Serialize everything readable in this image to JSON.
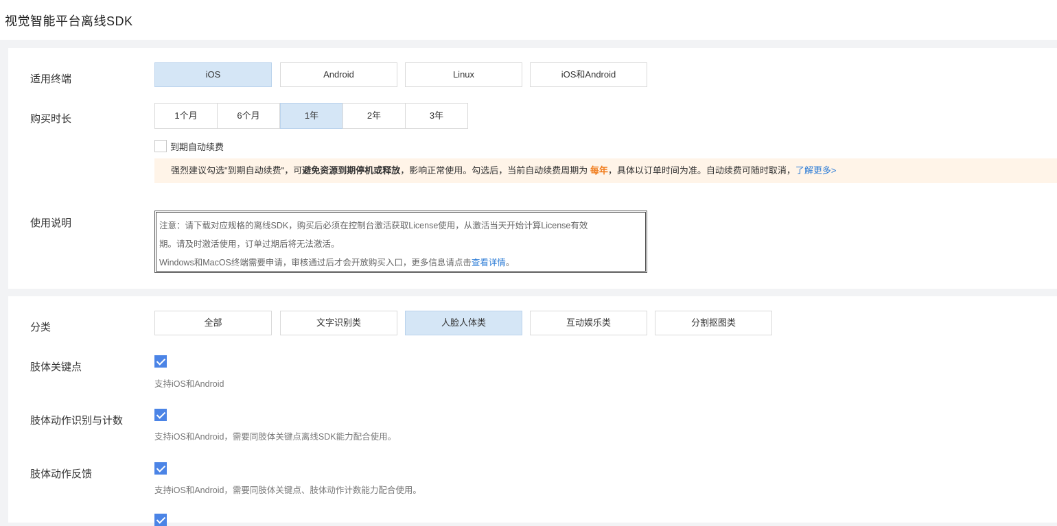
{
  "header": {
    "title": "视觉智能平台离线SDK"
  },
  "terminal": {
    "label": "适用终端",
    "options": [
      "iOS",
      "Android",
      "Linux",
      "iOS和Android"
    ],
    "selected": "iOS"
  },
  "duration": {
    "label": "购买时长",
    "options": [
      "1个月",
      "6个月",
      "1年",
      "2年",
      "3年"
    ],
    "selected": "1年"
  },
  "auto_renew": {
    "label": "到期自动续费",
    "checked": false
  },
  "notice": {
    "part1": "强烈建议勾选\"到期自动续费\"，可",
    "bold": "避免资源到期停机或释放",
    "part2": "，影响正常使用。勾选后，当前自动续费周期为 ",
    "period": "每年",
    "part3": "，具体以订单时间为准。自动续费可随时取消，",
    "link": "了解更多>"
  },
  "usage": {
    "label": "使用说明",
    "line1": "注意：请下载对应规格的离线SDK，购买后必须在控制台激活获取License使用，从激活当天开始计算License有效",
    "line2": "期。请及时激活使用，订单过期后将无法激活。",
    "line3_text": "Windows和MacOS终端需要申请，审核通过后才会开放购买入口，更多信息请点击",
    "line3_link": "查看详情",
    "line3_end": "。"
  },
  "category": {
    "label": "分类",
    "options": [
      "全部",
      "文字识别类",
      "人脸人体类",
      "互动娱乐类",
      "分割抠图类"
    ],
    "selected": "人脸人体类"
  },
  "features": [
    {
      "label": "肢体关键点",
      "checked": true,
      "sub": "支持iOS和Android"
    },
    {
      "label": "肢体动作识别与计数",
      "checked": true,
      "sub": "支持iOS和Android，需要同肢体关键点离线SDK能力配合使用。"
    },
    {
      "label": "肢体动作反馈",
      "checked": true,
      "sub": "支持iOS和Android，需要同肢体关键点、肢体动作计数能力配合使用。"
    }
  ],
  "colors": {
    "accent": "#4b84e6",
    "selected_bg": "#d5e6f6",
    "notice_bg": "#fff4e8",
    "highlight": "#f07c1c",
    "link": "#2b7bd6"
  }
}
